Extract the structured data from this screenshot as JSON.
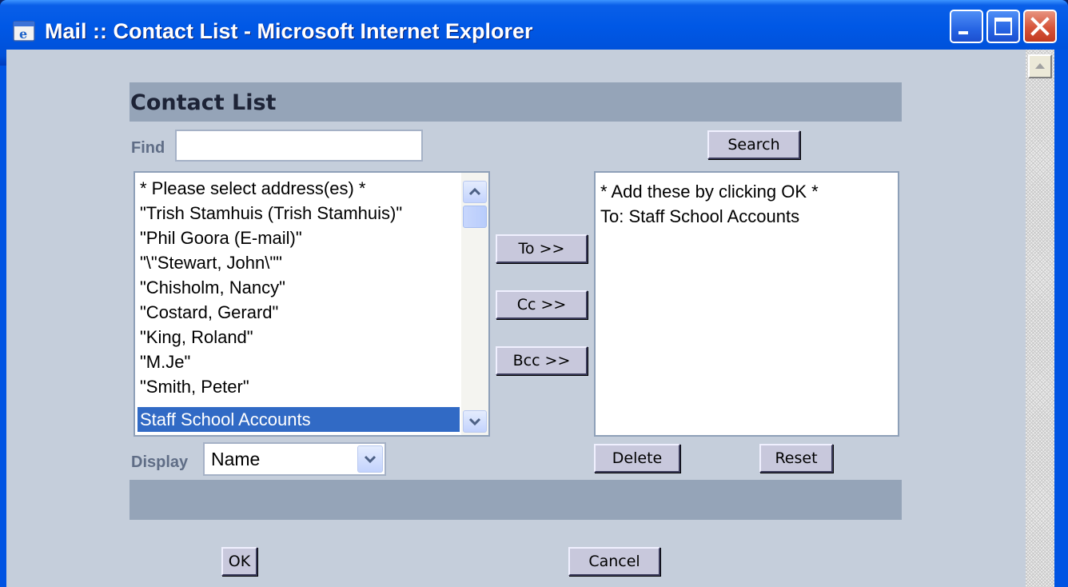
{
  "window": {
    "title": "Mail :: Contact List - Microsoft Internet Explorer"
  },
  "page": {
    "heading": "Contact List",
    "find_label": "Find",
    "find_value": "",
    "search_button": "Search",
    "display_label": "Display",
    "display_selected": "Name"
  },
  "contacts": {
    "items": [
      "* Please select address(es) *",
      "\"Trish Stamhuis (Trish Stamhuis)\"",
      "\"Phil Goora (E-mail)\"",
      "\"\\\"Stewart, John\\\"\"",
      "\"Chisholm, Nancy\"",
      "\"Costard, Gerard\"",
      "\"King, Roland\"",
      "\"M.Je\"",
      "\"Smith, Peter\"",
      "Staff School Accounts"
    ],
    "selected_index": 9
  },
  "buttons": {
    "to": "To >>",
    "cc": "Cc >>",
    "bcc": "Bcc >>",
    "delete": "Delete",
    "reset": "Reset",
    "ok": "OK",
    "cancel": "Cancel"
  },
  "recipients": {
    "items": [
      "* Add these by clicking OK *",
      "To: Staff School Accounts"
    ]
  },
  "colors": {
    "selection": "#316ac5",
    "panel_bar": "#95a4b8",
    "background": "#c5cedb"
  }
}
